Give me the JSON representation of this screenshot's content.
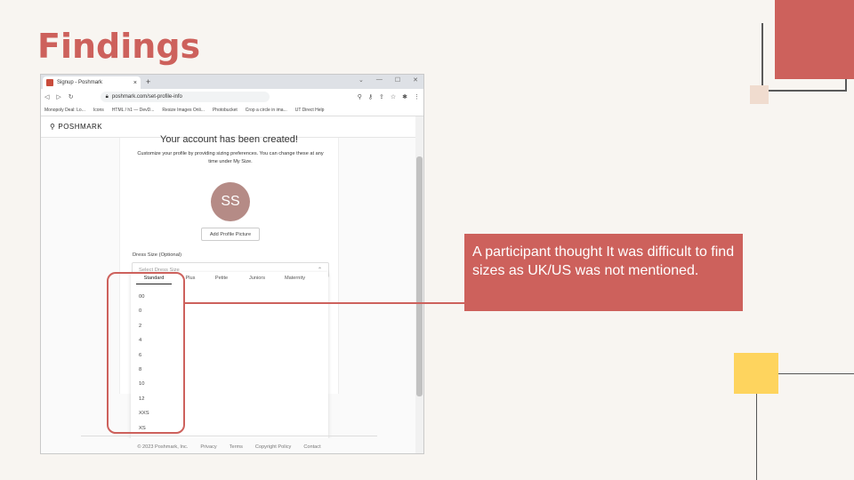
{
  "slide": {
    "title": "Findings",
    "callout": "A participant thought It was difficult to find sizes as UK/US was not mentioned."
  },
  "browser": {
    "tab_title": "Signup - Poshmark",
    "tab_close": "×",
    "new_tab": "+",
    "window_controls": [
      "⌄",
      "—",
      "☐",
      "✕"
    ],
    "url": "poshmark.com/set-profile-info",
    "bookmarks": [
      "Monopoly Deal: Lo...",
      "Icons",
      "HTML / h1 — DevD...",
      "Resize Images Onli...",
      "Photobucket",
      "Crop a circle in ima...",
      "UT Direct Help"
    ]
  },
  "poshmark": {
    "logo": "POSHMARK",
    "heading": "Your account has been created!",
    "subtitle": "Customize your profile by providing sizing preferences. You can change these at any time under My Size.",
    "avatar_initials": "SS",
    "add_picture": "Add Profile Picture",
    "dress_size_label": "Dress Size (Optional)",
    "select_placeholder": "Select Dress Size",
    "size_tabs": [
      "Standard",
      "Plus",
      "Petite",
      "Juniors",
      "Maternity"
    ],
    "sizes": [
      "00",
      "0",
      "2",
      "4",
      "6",
      "8",
      "10",
      "12",
      "XXS",
      "XS"
    ],
    "footer_links": [
      "© 2023 Poshmark, Inc.",
      "Privacy",
      "Terms",
      "Copyright Policy",
      "Contact"
    ]
  },
  "colors": {
    "accent": "#cd615c",
    "yellow": "#fed45e",
    "avatar": "#b58b86"
  }
}
